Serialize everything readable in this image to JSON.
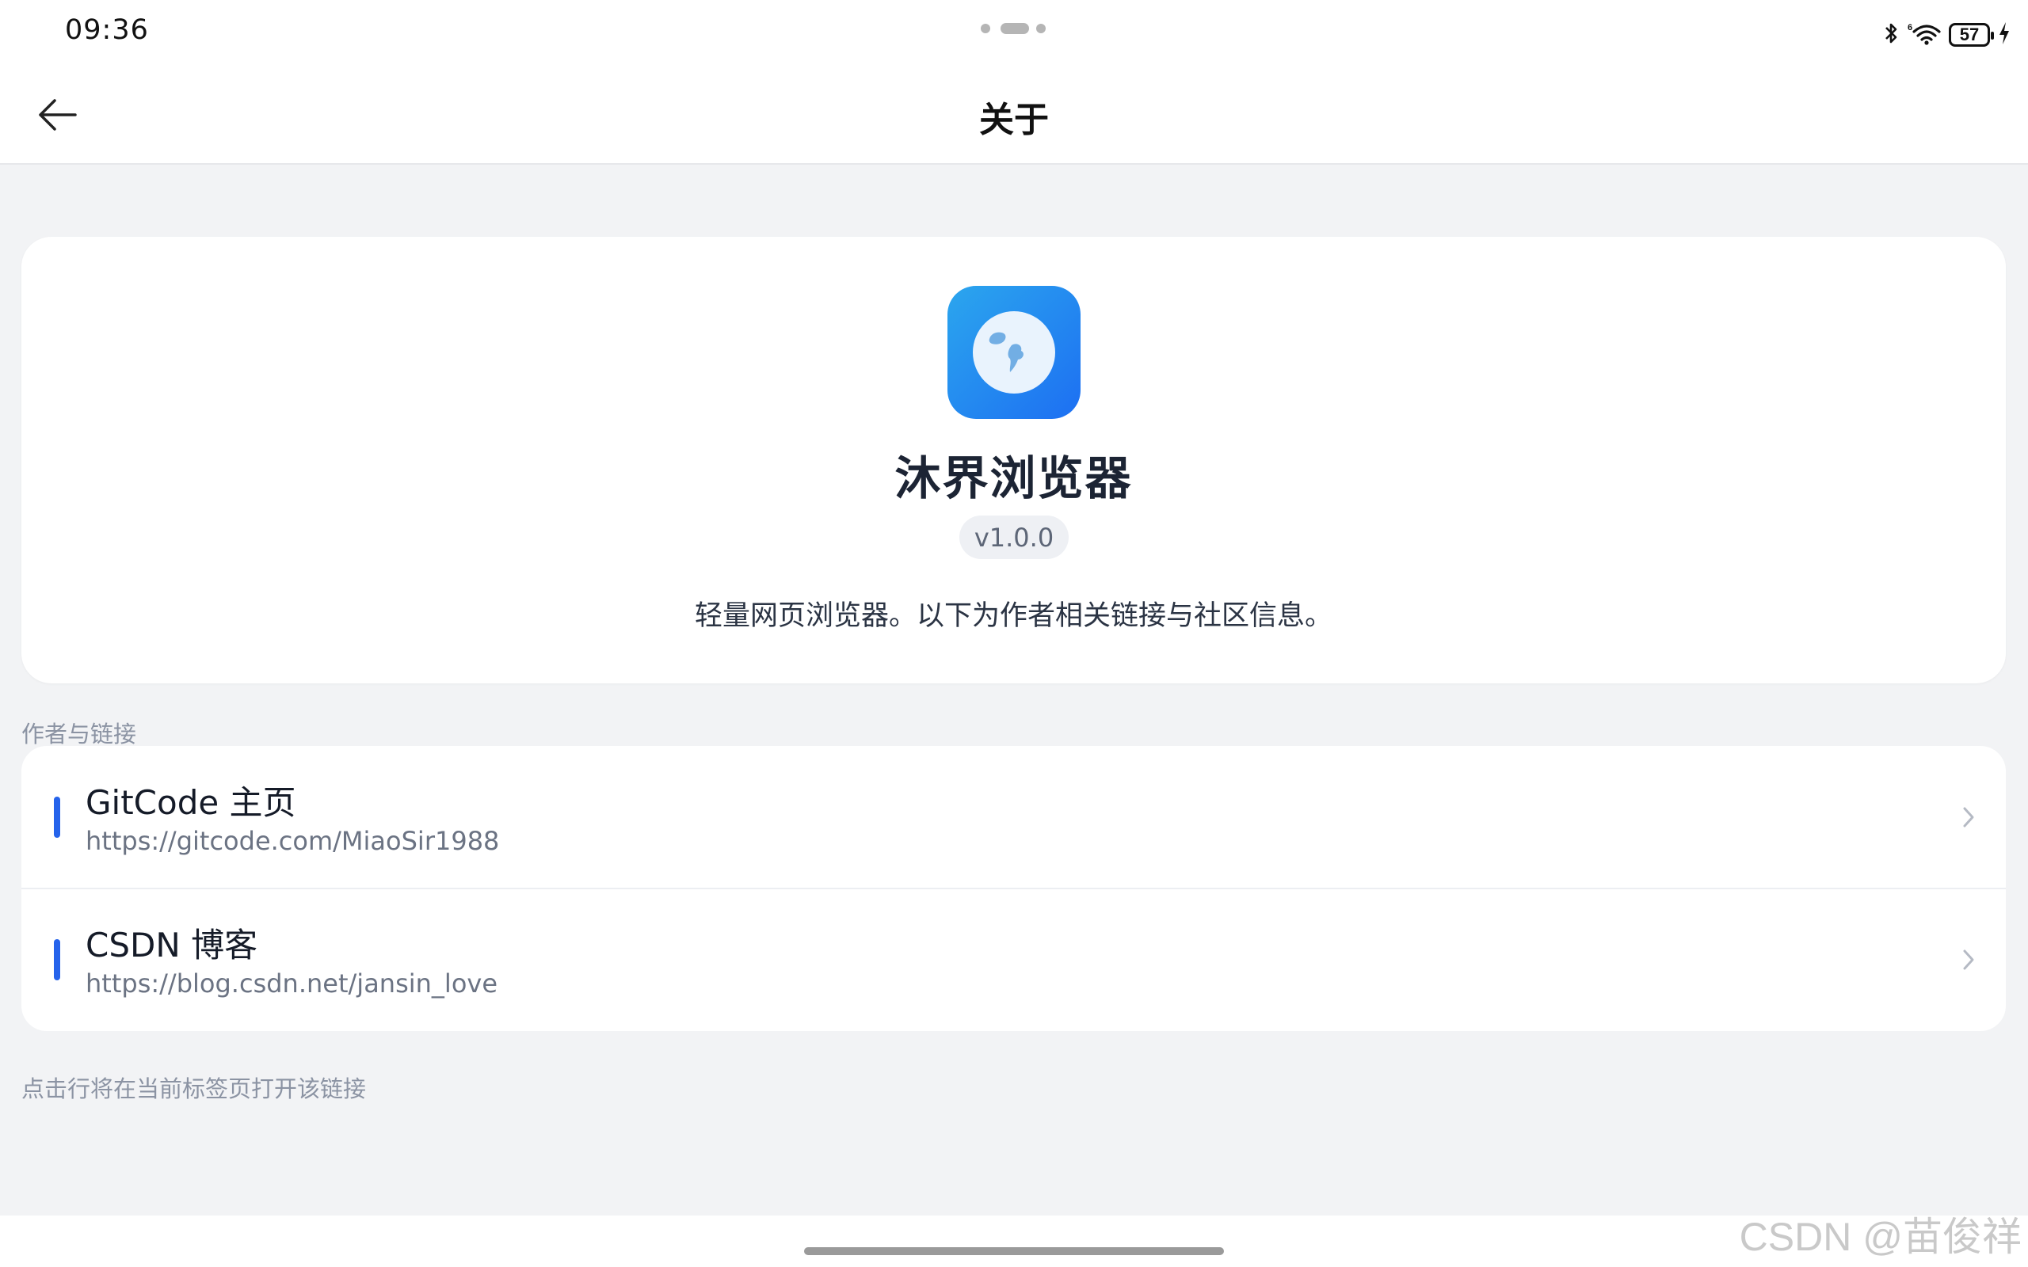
{
  "status_bar": {
    "time": "09:36",
    "battery": "57",
    "icons": [
      "bluetooth-icon",
      "wifi-icon",
      "battery-icon",
      "charging-icon"
    ]
  },
  "header": {
    "title": "关于",
    "back_icon": "arrow-left-icon"
  },
  "app": {
    "name": "沐界浏览器",
    "version": "v1.0.0",
    "description": "轻量网页浏览器。以下为作者相关链接与社区信息。",
    "icon": "globe-icon"
  },
  "links_section": {
    "label": "作者与链接",
    "items": [
      {
        "title": "GitCode 主页",
        "url": "https://gitcode.com/MiaoSir1988"
      },
      {
        "title": "CSDN 博客",
        "url": "https://blog.csdn.net/jansin_love"
      }
    ],
    "hint": "点击行将在当前标签页打开该链接"
  },
  "watermark": "CSDN @苗俊祥",
  "colors": {
    "accent": "#2563eb",
    "background": "#f2f3f5",
    "card": "#ffffff",
    "icon_gradient_start": "#2ba6ee",
    "icon_gradient_end": "#1d6ff2"
  }
}
